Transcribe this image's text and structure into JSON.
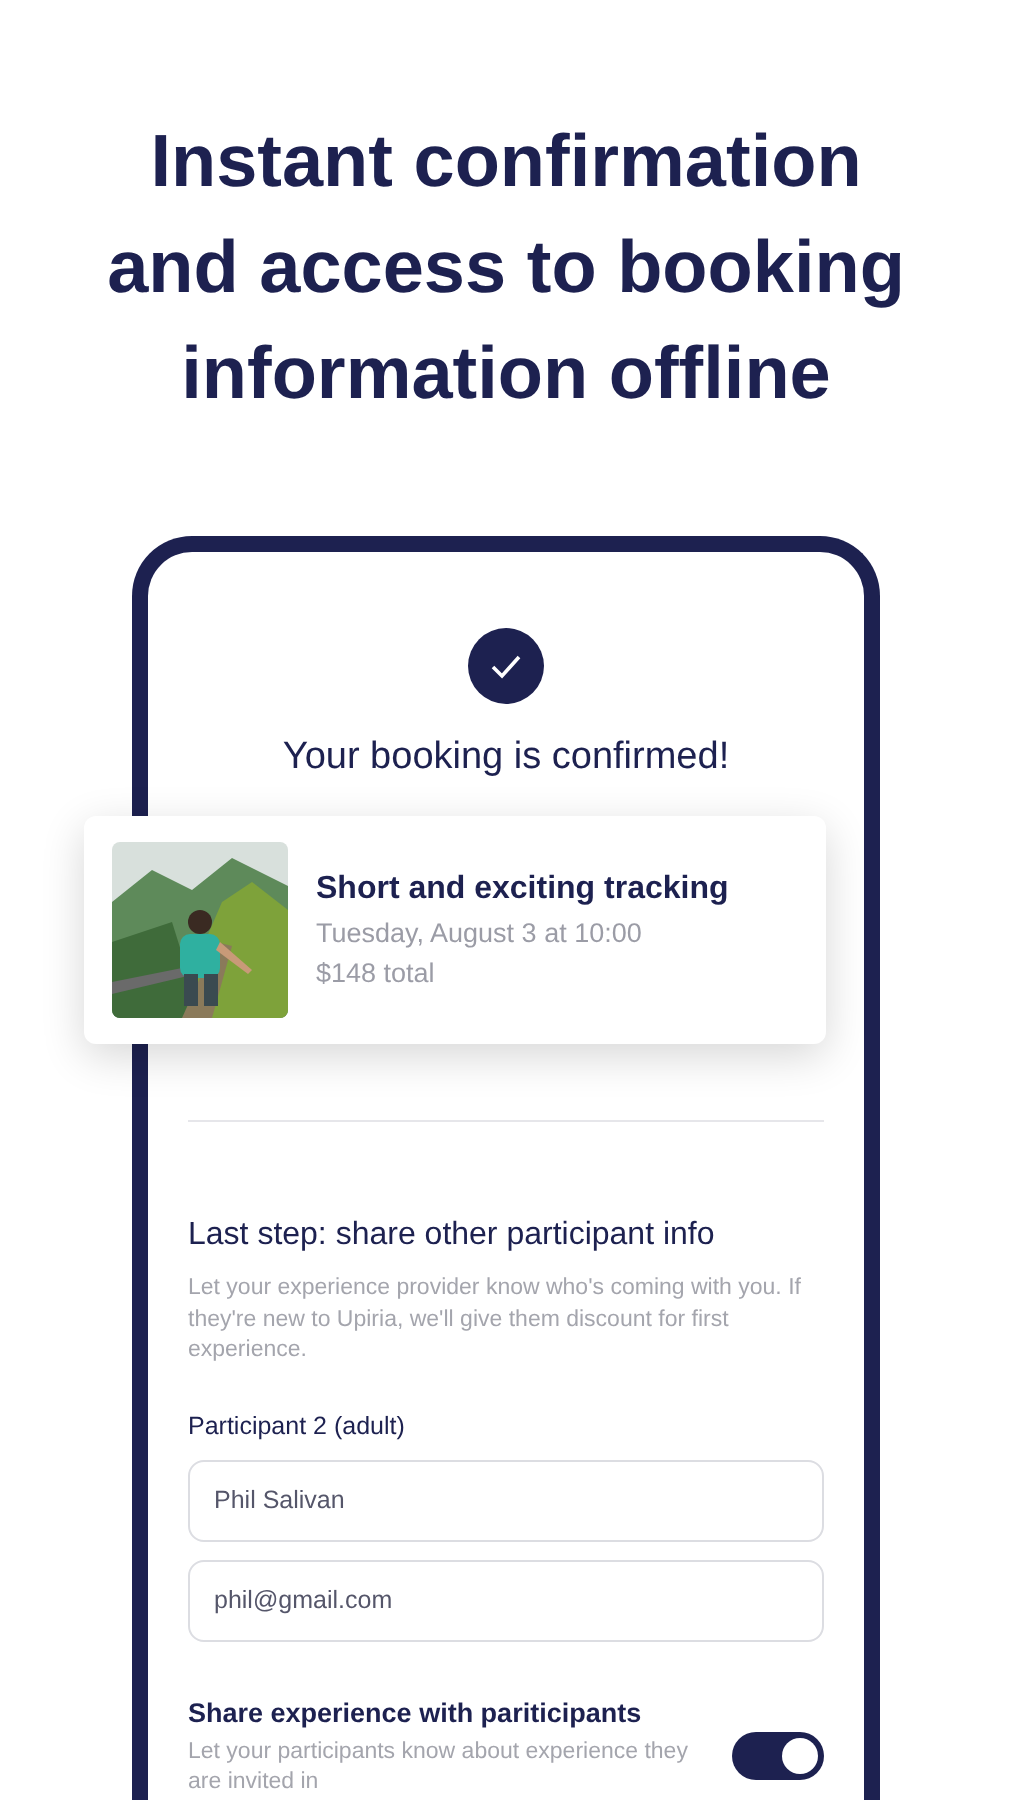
{
  "headline_lines": [
    "Instant confirmation",
    "and access to booking",
    "information offline"
  ],
  "confirmation": {
    "title": "Your booking is confirmed!"
  },
  "booking": {
    "title": "Short and exciting tracking",
    "date": "Tuesday, August 3 at 10:00",
    "price": "$148 total"
  },
  "participant_info": {
    "heading": "Last step: share other participant info",
    "description": "Let your experience provider know who's coming with you. If they're new to Upiria, we'll give them discount for first experience.",
    "participant_label": "Participant 2 (adult)",
    "fields": [
      {
        "value": "Phil Salivan"
      },
      {
        "value": "phil@gmail.com"
      }
    ]
  },
  "share": {
    "title": "Share experience with pariticipants",
    "description": "Let your participants know about experience they are invited in",
    "on": true
  }
}
